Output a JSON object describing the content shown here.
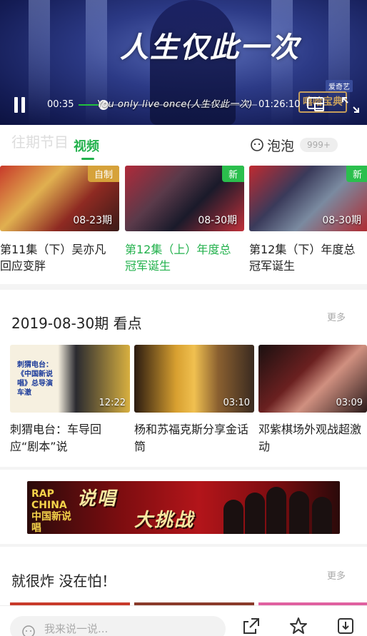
{
  "player": {
    "title_art": "人生仅此一次",
    "subtitle": "You only live once(人生仅此一次)",
    "current_time": "00:35",
    "total_time": "01:26:10",
    "progress": 0.14,
    "badge": "爱奇艺",
    "watermark": "嘻哈宝典"
  },
  "tabs": {
    "ghost_text": "往期节目",
    "video_label": "视频",
    "bubble_label": "泡泡",
    "bubble_count": "999+"
  },
  "episodes": [
    {
      "tag": "自制",
      "date": "08-23期",
      "title": "第11集（下）吴亦凡回应变胖",
      "active": false
    },
    {
      "tag": "新",
      "date": "08-30期",
      "title": "第12集（上）年度总冠军诞生",
      "active": true
    },
    {
      "tag": "新",
      "date": "08-30期",
      "title": "第12集（下）年度总冠军诞生",
      "active": false
    }
  ],
  "section1": {
    "title": "2019-08-30期  看点",
    "more": "更多",
    "clips": [
      {
        "duration": "12:22",
        "title": "刺猬电台：车导回应“剧本”说",
        "overlay": "刺猬电台：《中国新说唱》总导演车澈"
      },
      {
        "duration": "03:10",
        "title": "杨和苏福克斯分享金话筒"
      },
      {
        "duration": "03:09",
        "title": "邓紫棋场外观战超激动"
      }
    ]
  },
  "banner": {
    "left_text": "RAP CHINA 中国新说唱",
    "main_text": "说唱",
    "sub_text": "大挑战"
  },
  "section2": {
    "title": "就很炸  没在怕！",
    "more": "更多"
  },
  "bottom_bar": {
    "comment_placeholder": "我来说一说..."
  },
  "colors": {
    "accent": "#22b14c",
    "tag_new": "#2bbf4d",
    "tag_self": "#d6a23a"
  }
}
